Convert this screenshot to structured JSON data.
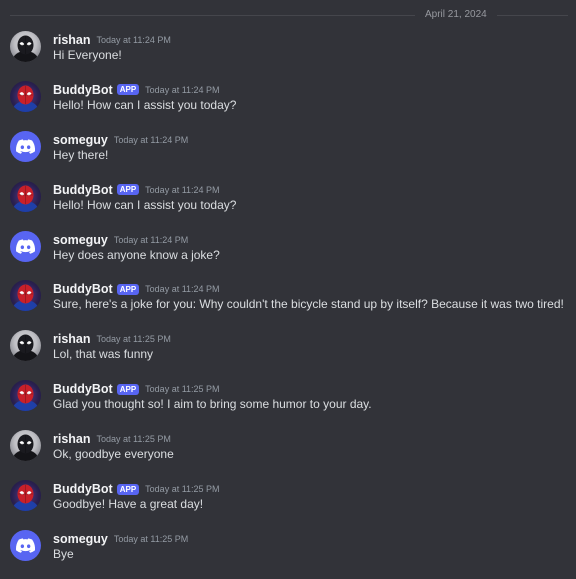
{
  "date_divider": "April 21, 2024",
  "colors": {
    "background": "#323339",
    "discord_blurple": "#5865f2"
  },
  "messages": [
    {
      "author": "rishan",
      "avatar": "rishan-avatar",
      "is_app": false,
      "badge": "",
      "timestamp": "Today at 11:24 PM",
      "content": "Hi Everyone!"
    },
    {
      "author": "BuddyBot",
      "avatar": "buddybot-avatar",
      "is_app": true,
      "badge": "APP",
      "timestamp": "Today at 11:24 PM",
      "content": "Hello! How can I assist you today?"
    },
    {
      "author": "someguy",
      "avatar": "discord-default-avatar",
      "is_app": false,
      "badge": "",
      "timestamp": "Today at 11:24 PM",
      "content": "Hey there!"
    },
    {
      "author": "BuddyBot",
      "avatar": "buddybot-avatar",
      "is_app": true,
      "badge": "APP",
      "timestamp": "Today at 11:24 PM",
      "content": "Hello! How can I assist you today?"
    },
    {
      "author": "someguy",
      "avatar": "discord-default-avatar",
      "is_app": false,
      "badge": "",
      "timestamp": "Today at 11:24 PM",
      "content": "Hey does anyone know a joke?"
    },
    {
      "author": "BuddyBot",
      "avatar": "buddybot-avatar",
      "is_app": true,
      "badge": "APP",
      "timestamp": "Today at 11:24 PM",
      "content": "Sure, here's a joke for you: Why couldn't the bicycle stand up by itself? Because it was two tired!"
    },
    {
      "author": "rishan",
      "avatar": "rishan-avatar",
      "is_app": false,
      "badge": "",
      "timestamp": "Today at 11:25 PM",
      "content": "Lol, that was funny"
    },
    {
      "author": "BuddyBot",
      "avatar": "buddybot-avatar",
      "is_app": true,
      "badge": "APP",
      "timestamp": "Today at 11:25 PM",
      "content": "Glad you thought so! I aim to bring some humor to your day."
    },
    {
      "author": "rishan",
      "avatar": "rishan-avatar",
      "is_app": false,
      "badge": "",
      "timestamp": "Today at 11:25 PM",
      "content": "Ok, goodbye everyone"
    },
    {
      "author": "BuddyBot",
      "avatar": "buddybot-avatar",
      "is_app": true,
      "badge": "APP",
      "timestamp": "Today at 11:25 PM",
      "content": "Goodbye! Have a great day!"
    },
    {
      "author": "someguy",
      "avatar": "discord-default-avatar",
      "is_app": false,
      "badge": "",
      "timestamp": "Today at 11:25 PM",
      "content": "Bye"
    }
  ]
}
